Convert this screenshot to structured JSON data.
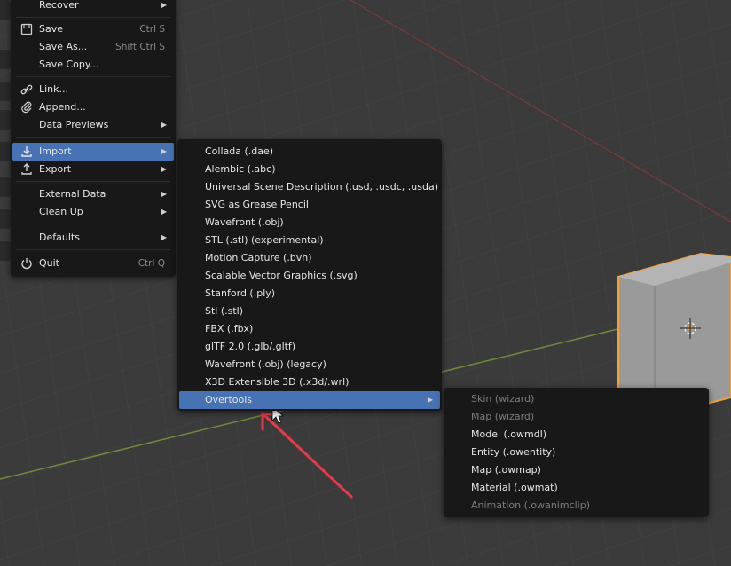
{
  "colors": {
    "highlight": "#4772b3",
    "menu_bg": "#181818",
    "cube_outline": "#f2a13b",
    "annotation_arrow": "#e8394b"
  },
  "file_menu": {
    "recover": "Recover",
    "save": "Save",
    "save_shortcut": "Ctrl S",
    "save_as": "Save As...",
    "save_as_shortcut": "Shift Ctrl S",
    "save_copy": "Save Copy...",
    "link": "Link...",
    "append": "Append...",
    "data_previews": "Data Previews",
    "import": "Import",
    "export": "Export",
    "external_data": "External Data",
    "clean_up": "Clean Up",
    "defaults": "Defaults",
    "quit": "Quit",
    "quit_shortcut": "Ctrl Q"
  },
  "import_menu": [
    "Collada (.dae)",
    "Alembic (.abc)",
    "Universal Scene Description (.usd, .usdc, .usda)",
    "SVG as Grease Pencil",
    "Wavefront (.obj)",
    "STL (.stl) (experimental)",
    "Motion Capture (.bvh)",
    "Scalable Vector Graphics (.svg)",
    "Stanford (.ply)",
    "Stl (.stl)",
    "FBX (.fbx)",
    "glTF 2.0 (.glb/.gltf)",
    "Wavefront (.obj) (legacy)",
    "X3D Extensible 3D (.x3d/.wrl)",
    "Overtools"
  ],
  "overtools_menu": [
    {
      "label": "Skin (wizard)",
      "enabled": false
    },
    {
      "label": "Map (wizard)",
      "enabled": false
    },
    {
      "label": "Model (.owmdl)",
      "enabled": true
    },
    {
      "label": "Entity (.owentity)",
      "enabled": true
    },
    {
      "label": "Map (.owmap)",
      "enabled": true
    },
    {
      "label": "Material (.owmat)",
      "enabled": true
    },
    {
      "label": "Animation (.owanimclip)",
      "enabled": false
    }
  ]
}
